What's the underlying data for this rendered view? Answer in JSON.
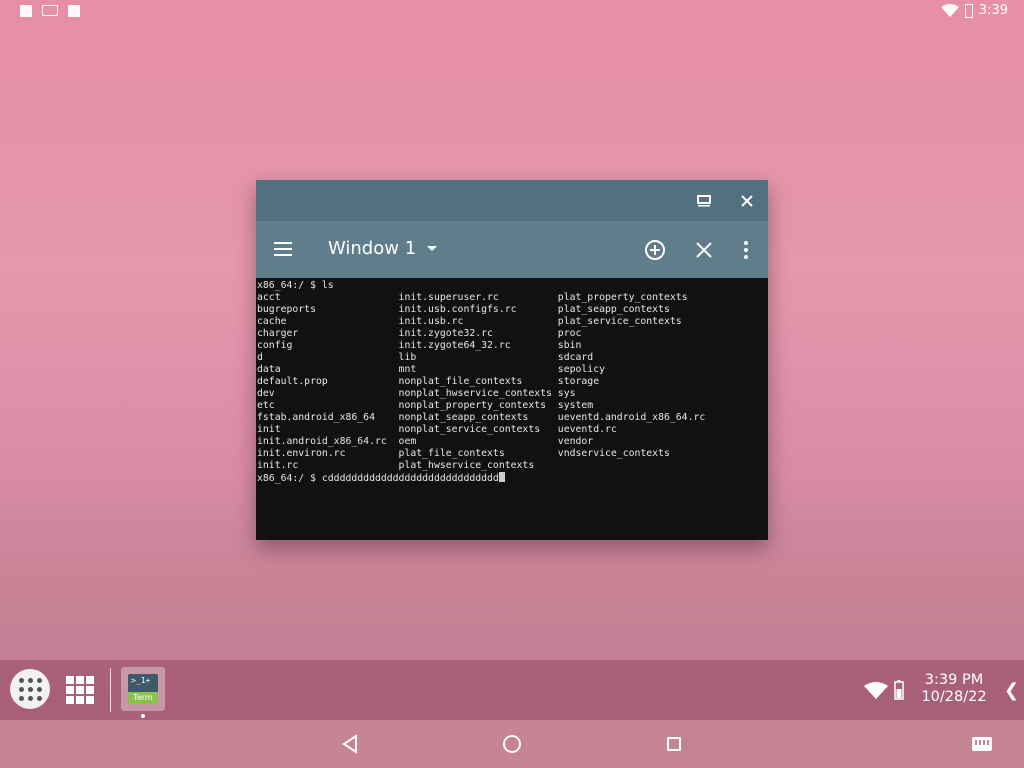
{
  "status_bar": {
    "time": "3:39",
    "notification_icons": [
      "a-icon",
      "sd-card-icon",
      "sim-icon"
    ]
  },
  "window": {
    "tab_title": "Window 1",
    "terminal_lines": [
      "x86_64:/ $ ls",
      "acct                    init.superuser.rc          plat_property_contexts",
      "bugreports              init.usb.configfs.rc       plat_seapp_contexts",
      "cache                   init.usb.rc                plat_service_contexts",
      "charger                 init.zygote32.rc           proc",
      "config                  init.zygote64_32.rc        sbin",
      "d                       lib                        sdcard",
      "data                    mnt                        sepolicy",
      "default.prop            nonplat_file_contexts      storage",
      "dev                     nonplat_hwservice_contexts sys",
      "etc                     nonplat_property_contexts  system",
      "fstab.android_x86_64    nonplat_seapp_contexts     ueventd.android_x86_64.rc",
      "init                    nonplat_service_contexts   ueventd.rc",
      "init.android_x86_64.rc  oem                        vendor",
      "init.environ.rc         plat_file_contexts         vndservice_contexts",
      "init.rc                 plat_hwservice_contexts"
    ],
    "prompt_line": "x86_64:/ $ cddddddddddddddddddddddddddddd"
  },
  "taskbar": {
    "pinned_app_line1": ">_1+",
    "pinned_app_line2": "Term",
    "time": "3:39 PM",
    "date": "10/28/22"
  },
  "colors": {
    "caption_bar": "#52707e",
    "toolbar": "#607d8b",
    "terminal_bg": "#111111",
    "terminal_fg": "#e6e6e6",
    "navbar": "#c48496"
  }
}
